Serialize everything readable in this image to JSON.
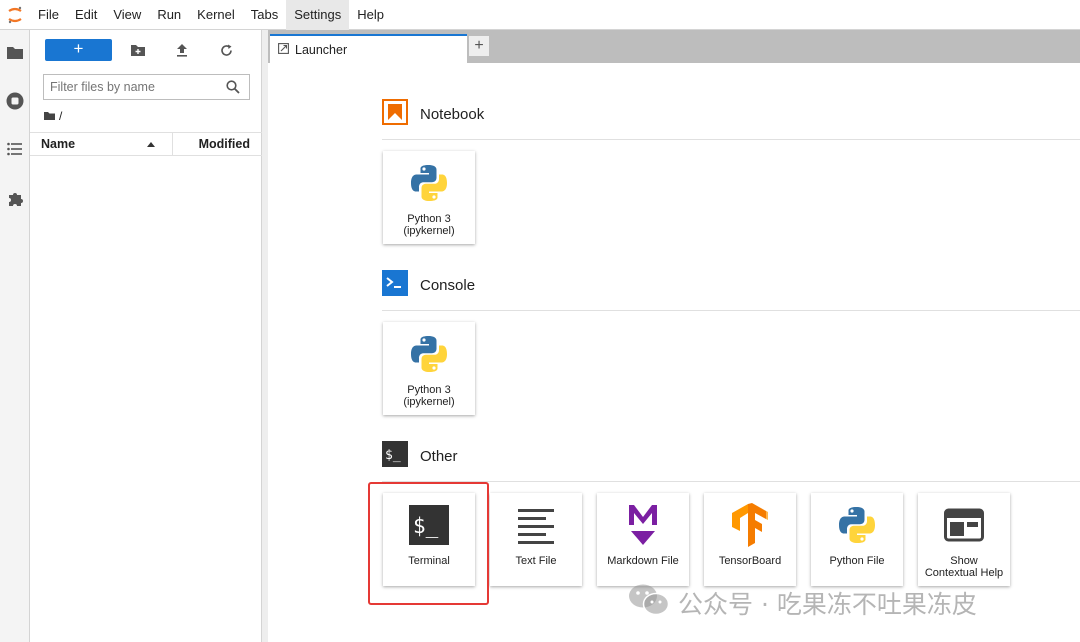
{
  "menubar": {
    "items": [
      "File",
      "Edit",
      "View",
      "Run",
      "Kernel",
      "Tabs",
      "Settings",
      "Help"
    ],
    "active": "Settings"
  },
  "activity_bar": {
    "icons": [
      "folder-icon",
      "running-icon",
      "table-of-contents-icon",
      "extension-icon"
    ]
  },
  "file_browser": {
    "new_label": "+",
    "filter_placeholder": "Filter files by name",
    "breadcrumb": "/",
    "columns": {
      "name": "Name",
      "modified": "Modified"
    }
  },
  "tabs": [
    {
      "label": "Launcher"
    }
  ],
  "launcher": {
    "sections": [
      {
        "title": "Notebook",
        "cards": [
          {
            "label": "Python 3 (ipykernel)"
          }
        ]
      },
      {
        "title": "Console",
        "cards": [
          {
            "label": "Python 3 (ipykernel)"
          }
        ]
      },
      {
        "title": "Other",
        "cards": [
          {
            "label": "Terminal"
          },
          {
            "label": "Text File"
          },
          {
            "label": "Markdown File"
          },
          {
            "label": "TensorBoard"
          },
          {
            "label": "Python File"
          },
          {
            "label": "Show Contextual Help"
          }
        ]
      }
    ]
  },
  "colors": {
    "accent": "#1976d2",
    "notebook": "#ef6c00",
    "console": "#1976d2",
    "highlight": "#e53935",
    "markdown": "#7b1fa2"
  },
  "watermark": {
    "text": "公众号 · 吃果冻不吐果冻皮"
  }
}
